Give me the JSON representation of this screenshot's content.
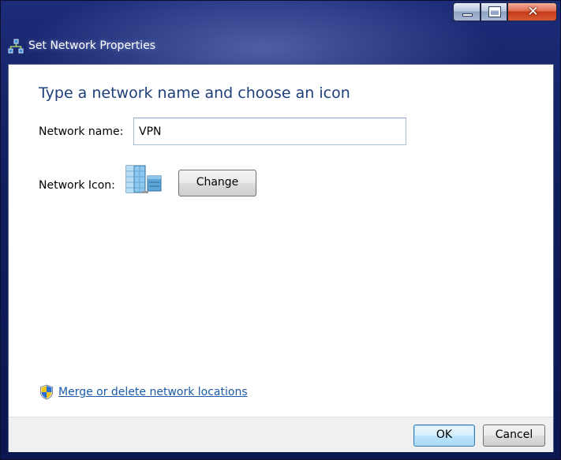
{
  "window": {
    "title": "Set Network Properties",
    "icon": "network-globe-icon",
    "caption_buttons": [
      "minimize-icon",
      "maximize-icon",
      "close-icon"
    ]
  },
  "content": {
    "heading": "Type a network name and choose an icon",
    "network_name_label": "Network name:",
    "network_name_value": "VPN",
    "network_icon_label": "Network Icon:",
    "network_icon": "office-building-icon",
    "change_button": "Change",
    "merge_link": "Merge or delete network locations",
    "merge_link_icon": "uac-shield-icon"
  },
  "footer": {
    "ok_label": "OK",
    "cancel_label": "Cancel"
  },
  "colors": {
    "heading": "#1e3f7a",
    "link": "#1a5aa8",
    "frame": "#111e5e"
  }
}
